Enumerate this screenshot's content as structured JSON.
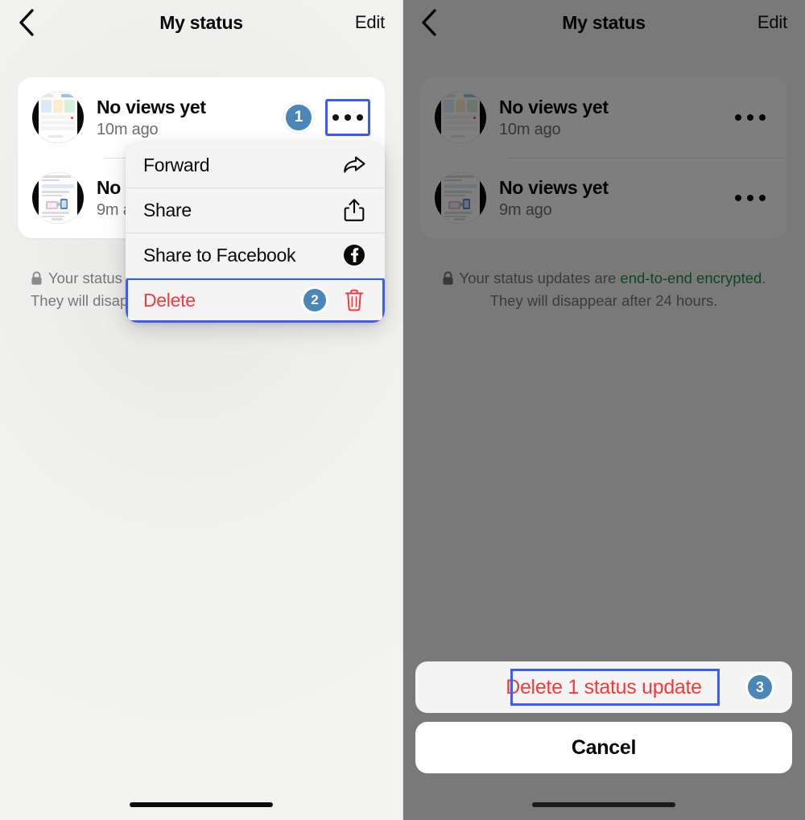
{
  "screens": [
    {
      "name": "context-menu-screen",
      "header": {
        "back_icon": "chevron-left-icon",
        "title": "My status",
        "action": "Edit"
      },
      "statuses": [
        {
          "title": "No views yet",
          "time": "10m ago",
          "badge": "1",
          "thumb": "settings-screenshot"
        },
        {
          "title": "No views yet",
          "time": "9m ago",
          "badge": "",
          "thumb": "tutorial-screenshot"
        }
      ],
      "encryption": {
        "lock_icon": "lock-icon",
        "prefix": "Your status updates are ",
        "link": "end-to-end encrypted",
        "suffix": ". They will disappear after 24 hours."
      },
      "context_menu": {
        "items": [
          {
            "label": "Forward",
            "icon": "forward-arrow-icon",
            "badge": "",
            "destructive": false,
            "highlighted": false
          },
          {
            "label": "Share",
            "icon": "share-icon",
            "badge": "",
            "destructive": false,
            "highlighted": false
          },
          {
            "label": "Share to Facebook",
            "icon": "facebook-icon",
            "badge": "",
            "destructive": false,
            "highlighted": false
          },
          {
            "label": "Delete",
            "icon": "trash-icon",
            "badge": "2",
            "destructive": true,
            "highlighted": true
          }
        ]
      }
    },
    {
      "name": "delete-confirm-screen",
      "header": {
        "back_icon": "chevron-left-icon",
        "title": "My status",
        "action": "Edit"
      },
      "statuses": [
        {
          "title": "No views yet",
          "time": "10m ago",
          "badge": "",
          "thumb": "settings-screenshot"
        },
        {
          "title": "No views yet",
          "time": "9m ago",
          "badge": "",
          "thumb": "tutorial-screenshot"
        }
      ],
      "encryption": {
        "lock_icon": "lock-icon",
        "prefix": "Your status updates are ",
        "link": "end-to-end encrypted",
        "suffix": ". They will disappear after 24 hours."
      },
      "action_sheet": {
        "delete_label": "Delete 1 status update",
        "delete_badge": "3",
        "cancel_label": "Cancel"
      }
    }
  ],
  "colors": {
    "accent_blue": "#3b5bfd",
    "badge_blue": "#4a86b8",
    "destructive_red": "#ef3b3b",
    "encrypted_green": "#1e8a4c",
    "panel_bg": "#f2f2f2",
    "dim_overlay": "#808080"
  }
}
